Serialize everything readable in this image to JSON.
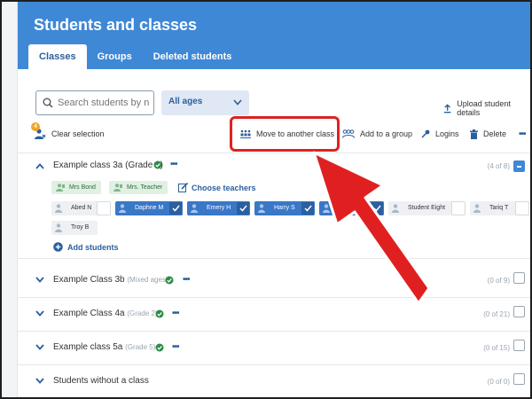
{
  "page": {
    "title": "Students and classes"
  },
  "tabs": [
    {
      "label": "Classes",
      "active": true
    },
    {
      "label": "Groups",
      "active": false
    },
    {
      "label": "Deleted students",
      "active": false
    }
  ],
  "search": {
    "placeholder": "Search students by name",
    "icon": "search-icon"
  },
  "age_filter": {
    "selected": "All ages",
    "icon": "chevron-down-icon"
  },
  "upload": {
    "label": "Upload student details",
    "icon": "upload-icon"
  },
  "toolbar": {
    "selection_count": "4",
    "clear_selection": "Clear selection",
    "move_to_class": "Move to another class",
    "add_to_group": "Add to a group",
    "logins": "Logins",
    "delete": "Delete",
    "more": "•••"
  },
  "classes": [
    {
      "name": "Example class 3a",
      "grade": "(Grade 3)",
      "verified": true,
      "count": "(4 of 8)",
      "expanded": true,
      "teachers": [
        "Mrs Bond",
        "Mrs. Teacher"
      ],
      "choose_teachers": "Choose teachers",
      "students": [
        {
          "name": "Abed N",
          "selected": false
        },
        {
          "name": "Daphne M",
          "selected": true
        },
        {
          "name": "Emery H",
          "selected": true
        },
        {
          "name": "Harry S",
          "selected": true
        },
        {
          "name": "S",
          "selected": true
        },
        {
          "name": "Student Eight",
          "selected": false
        },
        {
          "name": "Tariq T",
          "selected": false
        },
        {
          "name": "Troy B",
          "selected": false
        }
      ],
      "add_students": "Add students"
    },
    {
      "name": "Example Class 3b",
      "grade": "(Mixed ages)",
      "verified": true,
      "count": "(0 of 9)"
    },
    {
      "name": "Example Class 4a",
      "grade": "(Grade 2)",
      "verified": true,
      "count": "(0 of 21)"
    },
    {
      "name": "Example class 5a",
      "grade": "(Grade 5)",
      "verified": true,
      "count": "(0 of 15)"
    },
    {
      "name": "Students without a class",
      "grade": "",
      "verified": false,
      "count": "(0 of 0)"
    }
  ],
  "colors": {
    "header": "#3f88d6",
    "accent": "#2b5f9e",
    "highlight": "#dd2222",
    "teacher_pill": "#e0f0e3"
  }
}
